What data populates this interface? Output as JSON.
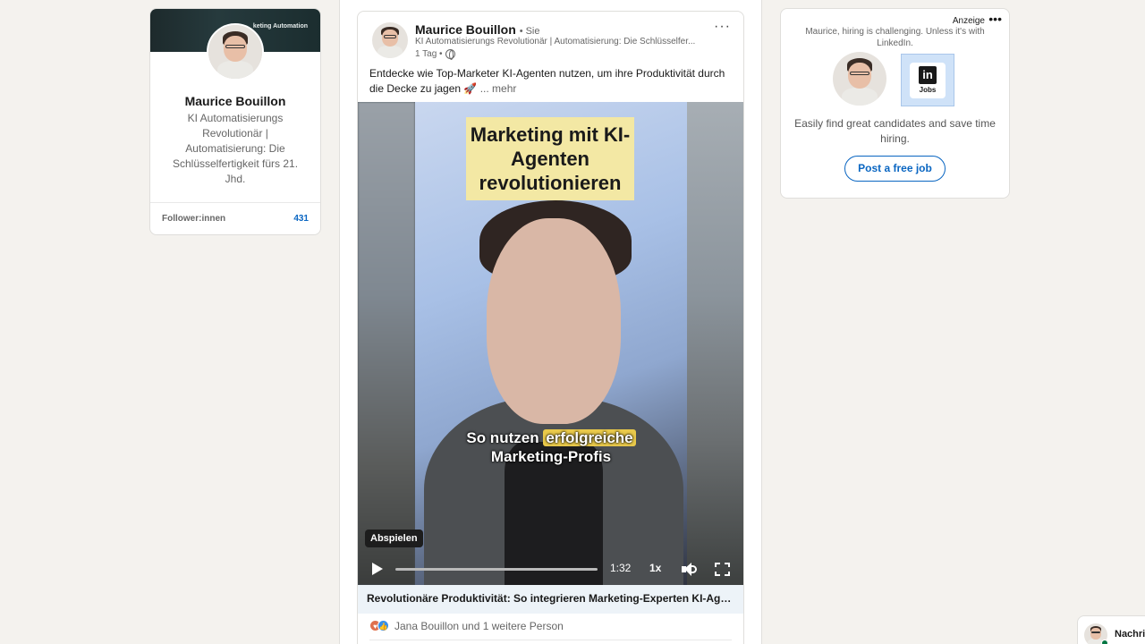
{
  "profile": {
    "banner_text": "keting Automation",
    "name": "Maurice Bouillon",
    "headline": "KI Automatisierungs Revolutionär | Automatisierung: Die Schlüsselfertigkeit fürs 21. Jhd.",
    "stat_label": "Follower:innen",
    "stat_value": "431"
  },
  "post": {
    "author": "Maurice Bouillon",
    "author_meta": "• Sie",
    "subtitle": "KI Automatisierungs Revolutionär | Automatisierung: Die Schlüsselfer...",
    "time": "1 Tag •",
    "menu": "···",
    "text": "Entdecke wie Top-Marketer KI-Agenten nutzen, um ihre Produktivität durch die Decke zu jagen",
    "rocket": "🚀",
    "more": "... mehr",
    "video": {
      "title": "Marketing mit KI-Agenten revolutionieren",
      "caption_prefix": "So nutzen ",
      "caption_highlight": "erfolgreiche",
      "caption_line2": "Marketing-Profis",
      "tooltip": "Abspielen",
      "time": "1:32",
      "speed": "1x",
      "progress": 0
    },
    "link_title": "Revolutionäre Produktivität: So integrieren Marketing-Experten KI-Agen...",
    "reactions_text": "Jana Bouillon und 1 weitere Person"
  },
  "ad": {
    "label": "Anzeige",
    "menu": "•••",
    "text": "Maurice, hiring is challenging. Unless it's with LinkedIn.",
    "jobs_logo": "in",
    "jobs_label": "Jobs",
    "description": "Easily find great candidates and save time hiring.",
    "button": "Post a free job"
  },
  "messaging": {
    "label": "Nachri"
  },
  "colors": {
    "accent": "#0a66c2",
    "page_bg": "#f4f2ee",
    "link_preview_bg": "#edf3f8",
    "caption_highlight": "#e9c94a",
    "title_box": "#f3e8a4"
  }
}
